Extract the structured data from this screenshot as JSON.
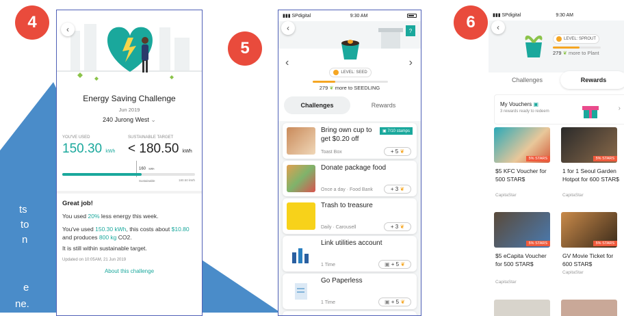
{
  "step_badges": [
    "4",
    "5",
    "6"
  ],
  "side_text": [
    "ts",
    "to",
    "n",
    "e",
    "ne."
  ],
  "screen4": {
    "title": "Energy Saving Challenge",
    "date": "Jun 2019",
    "address": "240 Jurong West",
    "used_label": "YOU'VE USED",
    "used_value": "150.30",
    "used_unit": "kWh",
    "target_label": "SUSTAINABLE TARGET",
    "target_value": "< 180.50",
    "target_unit": "kWh",
    "marker_value": "160",
    "marker_unit": "kWh",
    "marker_label": "Sustainable",
    "bar_end_label": "180.50 kWh",
    "progress_fraction": 0.6,
    "great_job": "Great job!",
    "line1_a": "You used ",
    "line1_b": "20%",
    "line1_c": " less energy this week.",
    "line2_a": "You've used ",
    "line2_b": "150.30 kWh",
    "line2_c": ", this costs about ",
    "line2_d": "$10.80",
    "line2_e": " and produces ",
    "line2_f": "800 kg",
    "line2_g": " CO2.",
    "line3": "It is still within sustainable target.",
    "updated": "Updated on 10:05AM, 21 Jun 2019",
    "about_link": "About this challenge"
  },
  "screen5": {
    "carrier": "SPdigital",
    "time": "9:30 AM",
    "help": "?",
    "level": "LEVEL: SEED",
    "level_progress": 0.3,
    "more_count": "279",
    "more_text": "more to SEEDLING",
    "tab_challenges": "Challenges",
    "tab_rewards": "Rewards",
    "challenges": [
      {
        "title": "Bring own cup to get $0.20 off",
        "sub": "Toast Box",
        "points": "+ 5",
        "stamp": "7/10 stamps"
      },
      {
        "title": "Donate package food",
        "sub": "Once a day · Food Bank",
        "points": "+ 3"
      },
      {
        "title": "Trash to treasure",
        "sub": "Daily · Carousell",
        "points": "+ 3"
      },
      {
        "title": "Link utilities account",
        "sub": "1 Time",
        "points": "+ 5"
      },
      {
        "title": "Go Paperless",
        "sub": "1 Time",
        "points": "+ 5"
      }
    ],
    "colors": {
      "accent": "#1aa89c",
      "seed": "#f5a623"
    }
  },
  "screen6": {
    "carrier": "SPdigital",
    "time": "9:30 AM",
    "level": "LEVEL: SPROUT",
    "level_progress": 0.55,
    "more_count": "279",
    "more_text": "more to Plant",
    "tab_challenges": "Challenges",
    "tab_rewards": "Rewards",
    "vouchers_title": "My Vouchers",
    "vouchers_sub": "3 rewards ready to redeem",
    "vouchers": [
      {
        "title": "$5 KFC Voucher for 500 STAR$",
        "sub": "CapitaStar",
        "tag": "5% STARS"
      },
      {
        "title": "1 for 1 Seoul Garden Hotpot for 600 STAR$",
        "sub": "CapitaStar",
        "tag": "5% STARS"
      },
      {
        "title": "$5 eCapita Voucher for 500 STAR$",
        "sub": "CapitaStar",
        "tag": "5% STARS"
      },
      {
        "title": "GV Movie Ticket for 600 STAR$",
        "sub": "CapitaStar",
        "tag": "5% STARS"
      }
    ]
  }
}
